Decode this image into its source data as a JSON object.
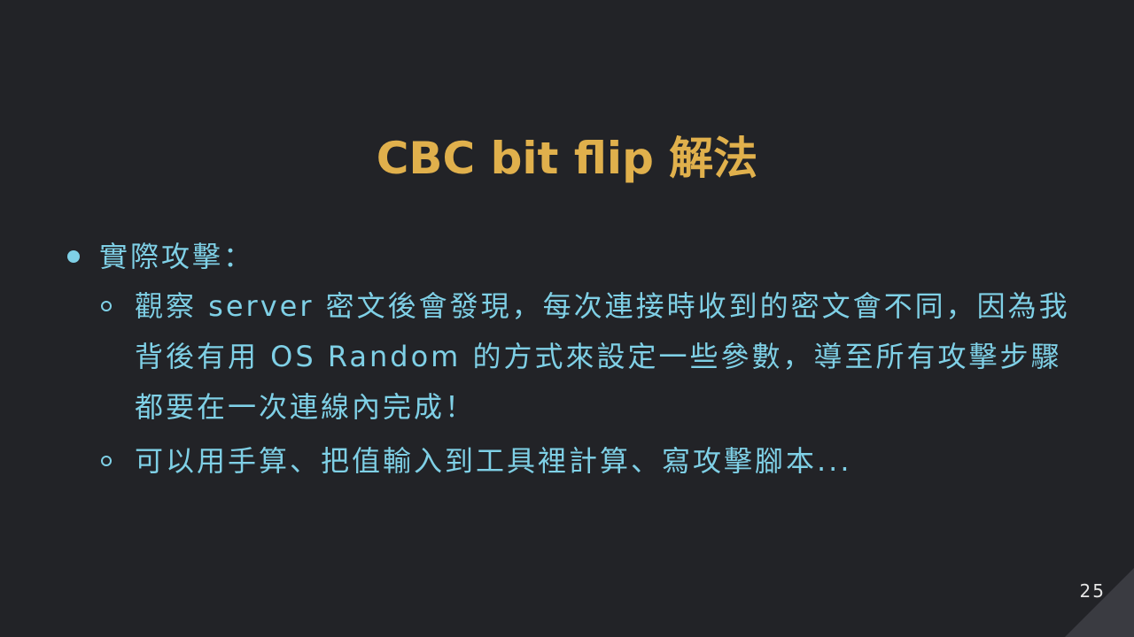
{
  "slide": {
    "title": "CBC bit flip 解法",
    "bullet": "實際攻擊：",
    "subbullets": [
      "觀察 server 密文後會發現，每次連接時收到的密文會不同，因為我背後有用 OS Random 的方式來設定一些參數，導至所有攻擊步驟都要在一次連線內完成！",
      "可以用手算、把值輸入到工具裡計算、寫攻擊腳本..."
    ],
    "page_number": "25"
  },
  "colors": {
    "background": "#222327",
    "title": "#e0b04c",
    "text": "#7fd0e6",
    "corner": "#3a3b41"
  }
}
